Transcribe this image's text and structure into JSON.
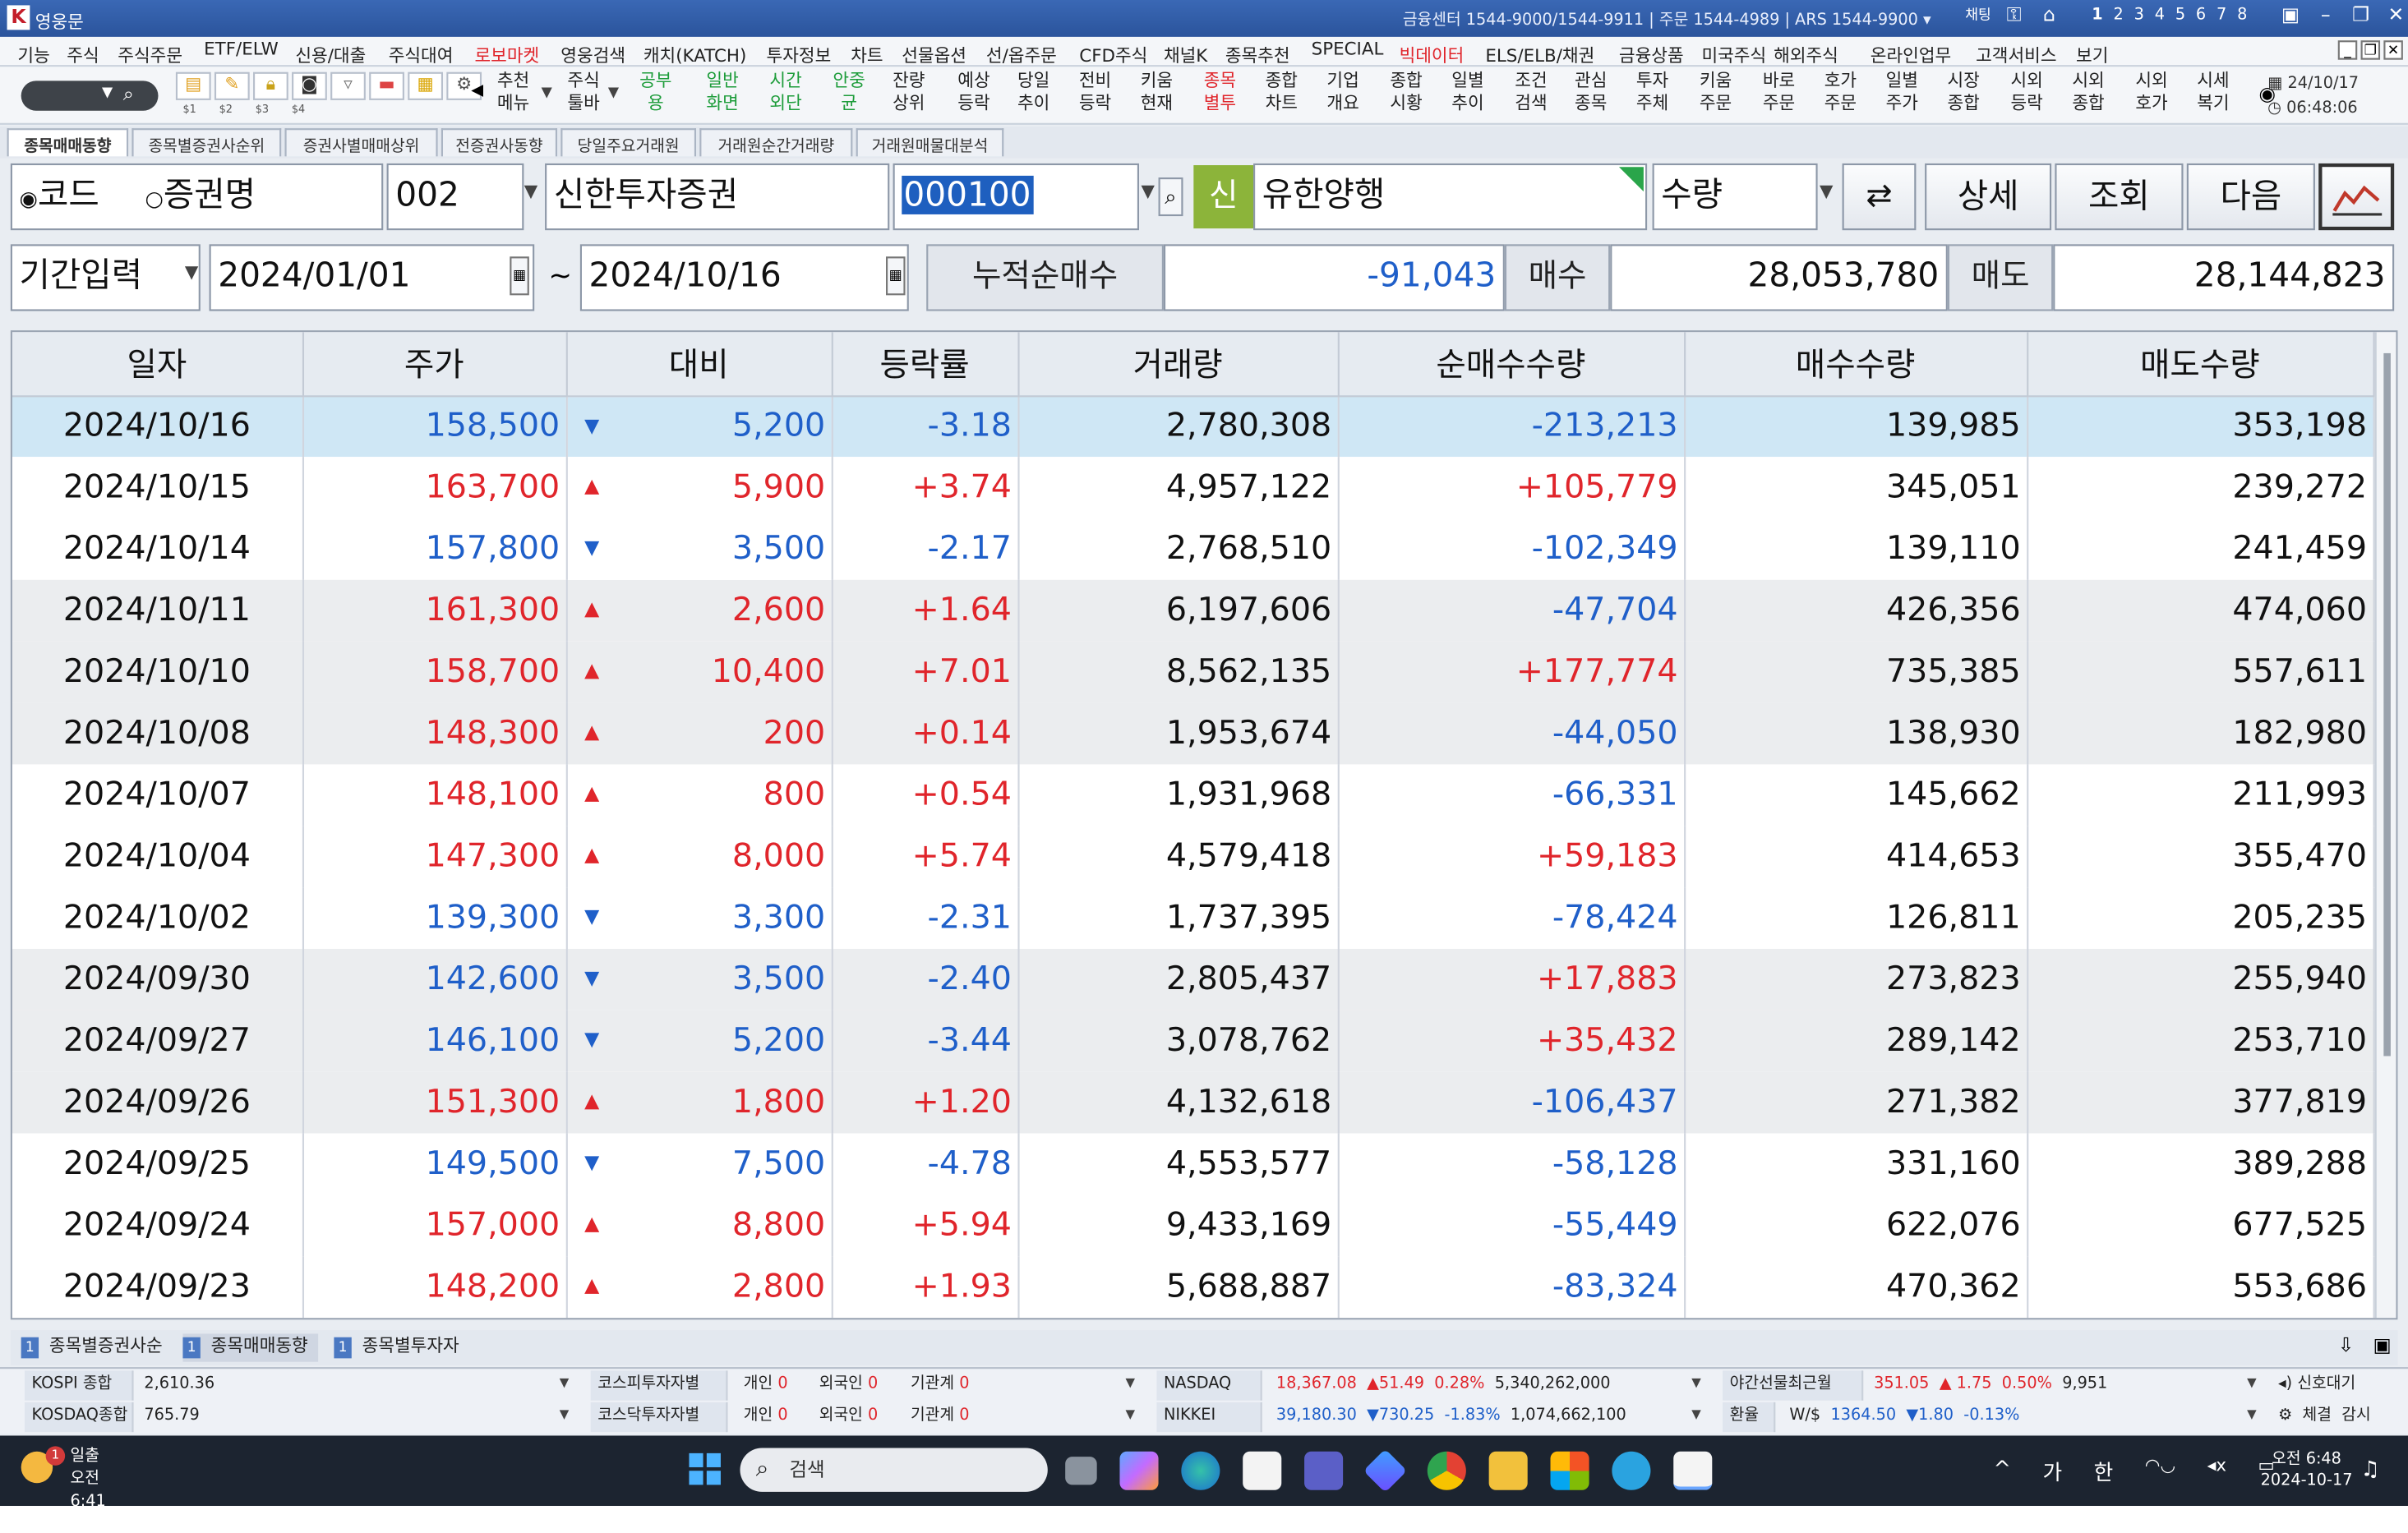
{
  "window": {
    "app_title": "영웅문",
    "contact": "금융센터 1544-9000/1544-9911 | 주문 1544-4989 | ARS 1544-9900 ▾",
    "screen_nums": [
      "1",
      "2",
      "3",
      "4",
      "5",
      "6",
      "7",
      "8"
    ],
    "chat": "채팅"
  },
  "menu": [
    "기능",
    "주식",
    "주식주문",
    "ETF/ELW",
    "신용/대출",
    "주식대여",
    "로보마켓",
    "영웅검색",
    "캐치(KATCH)",
    "투자정보",
    "차트",
    "선물옵션",
    "선/옵주문",
    "CFD주식",
    "채널K",
    "종목추천",
    "SPECIAL",
    "빅데이터",
    "ELS/ELB/채권",
    "금융상품",
    "미국주식",
    "해외주식",
    "온라인업무",
    "고객서비스",
    "보기"
  ],
  "toolbar": {
    "slots": [
      "$1",
      "$2",
      "$3",
      "$4"
    ],
    "tools": [
      {
        "l1": "추천",
        "l2": "메뉴",
        "c": ""
      },
      {
        "l1": "주식",
        "l2": "툴바",
        "c": ""
      },
      {
        "l1": "공부",
        "l2": "용",
        "c": "green"
      },
      {
        "l1": "일반",
        "l2": "화면",
        "c": "green"
      },
      {
        "l1": "시간",
        "l2": "외단",
        "c": "green"
      },
      {
        "l1": "안중",
        "l2": "균",
        "c": "green"
      },
      {
        "l1": "잔량",
        "l2": "상위",
        "c": ""
      },
      {
        "l1": "예상",
        "l2": "등락",
        "c": ""
      },
      {
        "l1": "당일",
        "l2": "추이",
        "c": ""
      },
      {
        "l1": "전비",
        "l2": "등락",
        "c": ""
      },
      {
        "l1": "키움",
        "l2": "현재",
        "c": ""
      },
      {
        "l1": "종목",
        "l2": "별투",
        "c": "red"
      },
      {
        "l1": "종합",
        "l2": "차트",
        "c": ""
      },
      {
        "l1": "기업",
        "l2": "개요",
        "c": ""
      },
      {
        "l1": "종합",
        "l2": "시황",
        "c": ""
      },
      {
        "l1": "일별",
        "l2": "추이",
        "c": ""
      },
      {
        "l1": "조건",
        "l2": "검색",
        "c": ""
      },
      {
        "l1": "관심",
        "l2": "종목",
        "c": ""
      },
      {
        "l1": "투자",
        "l2": "주체",
        "c": ""
      },
      {
        "l1": "키움",
        "l2": "주문",
        "c": ""
      },
      {
        "l1": "바로",
        "l2": "주문",
        "c": ""
      },
      {
        "l1": "호가",
        "l2": "주문",
        "c": ""
      },
      {
        "l1": "일별",
        "l2": "주가",
        "c": ""
      },
      {
        "l1": "시장",
        "l2": "종합",
        "c": ""
      },
      {
        "l1": "시외",
        "l2": "등락",
        "c": ""
      },
      {
        "l1": "시외",
        "l2": "종합",
        "c": ""
      },
      {
        "l1": "시외",
        "l2": "호가",
        "c": ""
      },
      {
        "l1": "시세",
        "l2": "복기",
        "c": ""
      }
    ],
    "date": "24/10/17",
    "time": "06:48:06"
  },
  "tabs": [
    "종목매매동향",
    "종목별증권사순위",
    "증권사별매매상위",
    "전증권사동향",
    "당일주요거래원",
    "거래원순간거래량",
    "거래원매물대분석"
  ],
  "form": {
    "radio_code": "코드",
    "radio_name": "증권명",
    "broker_code": "002",
    "broker_name": "신한투자증권",
    "stock_code": "000100",
    "stock_badge": "신",
    "stock_name": "유한양행",
    "unit": "수량",
    "btn_detail": "상세",
    "btn_query": "조회",
    "btn_next": "다음",
    "period_label": "기간입력",
    "date_from": "2024/01/01",
    "tilde": "~",
    "date_to": "2024/10/16",
    "cum_net_label": "누적순매수",
    "cum_net_value": "-91,043",
    "buy_label": "매수",
    "buy_value": "28,053,780",
    "sell_label": "매도",
    "sell_value": "28,144,823"
  },
  "columns": [
    "일자",
    "주가",
    "대비",
    "등락률",
    "거래량",
    "순매수수량",
    "매수수량",
    "매도수량"
  ],
  "rows": [
    {
      "date": "2024/10/16",
      "price": "158,500",
      "dir": "down",
      "diff": "5,200",
      "rate": "-3.18",
      "vol": "2,780,308",
      "net": "-213,213",
      "buy": "139,985",
      "sell": "353,198"
    },
    {
      "date": "2024/10/15",
      "price": "163,700",
      "dir": "up",
      "diff": "5,900",
      "rate": "+3.74",
      "vol": "4,957,122",
      "net": "+105,779",
      "buy": "345,051",
      "sell": "239,272"
    },
    {
      "date": "2024/10/14",
      "price": "157,800",
      "dir": "down",
      "diff": "3,500",
      "rate": "-2.17",
      "vol": "2,768,510",
      "net": "-102,349",
      "buy": "139,110",
      "sell": "241,459"
    },
    {
      "date": "2024/10/11",
      "price": "161,300",
      "dir": "up",
      "diff": "2,600",
      "rate": "+1.64",
      "vol": "6,197,606",
      "net": "-47,704",
      "buy": "426,356",
      "sell": "474,060"
    },
    {
      "date": "2024/10/10",
      "price": "158,700",
      "dir": "up",
      "diff": "10,400",
      "rate": "+7.01",
      "vol": "8,562,135",
      "net": "+177,774",
      "buy": "735,385",
      "sell": "557,611"
    },
    {
      "date": "2024/10/08",
      "price": "148,300",
      "dir": "up",
      "diff": "200",
      "rate": "+0.14",
      "vol": "1,953,674",
      "net": "-44,050",
      "buy": "138,930",
      "sell": "182,980"
    },
    {
      "date": "2024/10/07",
      "price": "148,100",
      "dir": "up",
      "diff": "800",
      "rate": "+0.54",
      "vol": "1,931,968",
      "net": "-66,331",
      "buy": "145,662",
      "sell": "211,993"
    },
    {
      "date": "2024/10/04",
      "price": "147,300",
      "dir": "up",
      "diff": "8,000",
      "rate": "+5.74",
      "vol": "4,579,418",
      "net": "+59,183",
      "buy": "414,653",
      "sell": "355,470"
    },
    {
      "date": "2024/10/02",
      "price": "139,300",
      "dir": "down",
      "diff": "3,300",
      "rate": "-2.31",
      "vol": "1,737,395",
      "net": "-78,424",
      "buy": "126,811",
      "sell": "205,235"
    },
    {
      "date": "2024/09/30",
      "price": "142,600",
      "dir": "down",
      "diff": "3,500",
      "rate": "-2.40",
      "vol": "2,805,437",
      "net": "+17,883",
      "buy": "273,823",
      "sell": "255,940"
    },
    {
      "date": "2024/09/27",
      "price": "146,100",
      "dir": "down",
      "diff": "5,200",
      "rate": "-3.44",
      "vol": "3,078,762",
      "net": "+35,432",
      "buy": "289,142",
      "sell": "253,710"
    },
    {
      "date": "2024/09/26",
      "price": "151,300",
      "dir": "up",
      "diff": "1,800",
      "rate": "+1.20",
      "vol": "4,132,618",
      "net": "-106,437",
      "buy": "271,382",
      "sell": "377,819"
    },
    {
      "date": "2024/09/25",
      "price": "149,500",
      "dir": "down",
      "diff": "7,500",
      "rate": "-4.78",
      "vol": "4,553,577",
      "net": "-58,128",
      "buy": "331,160",
      "sell": "389,288"
    },
    {
      "date": "2024/09/24",
      "price": "157,000",
      "dir": "up",
      "diff": "8,800",
      "rate": "+5.94",
      "vol": "9,433,169",
      "net": "-55,449",
      "buy": "622,076",
      "sell": "677,525"
    },
    {
      "date": "2024/09/23",
      "price": "148,200",
      "dir": "up",
      "diff": "2,800",
      "rate": "+1.93",
      "vol": "5,688,887",
      "net": "-83,324",
      "buy": "470,362",
      "sell": "553,686"
    }
  ],
  "bottom_tabs": [
    {
      "num": "1",
      "label": "종목별증권사순"
    },
    {
      "num": "1",
      "label": "종목매매동향"
    },
    {
      "num": "1",
      "label": "종목별투자자"
    }
  ],
  "status": {
    "kospi_label": "KOSPI 종합",
    "kospi_value": "2,610.36",
    "kosdaq_label": "KOSDAQ종합",
    "kosdaq_value": "765.79",
    "kospi_inv_label": "코스피투자자별",
    "kosdaq_inv_label": "코스닥투자자별",
    "inv_individual": "개인",
    "inv_foreign": "외국인",
    "inv_inst": "기관계",
    "inv_zero": "0",
    "nasdaq_label": "NASDAQ",
    "nasdaq_value": "18,367.08",
    "nasdaq_chg": "▲51.49",
    "nasdaq_pct": "0.28%",
    "nasdaq_vol": "5,340,262,000",
    "nikkei_label": "NIKKEI",
    "nikkei_value": "39,180.30",
    "nikkei_chg": "▼730.25",
    "nikkei_pct": "-1.83%",
    "nikkei_vol": "1,074,662,100",
    "night_label": "야간선물최근월",
    "night_value": "351.05",
    "night_chg": "▲ 1.75",
    "night_pct": "0.50%",
    "night_vol": "9,951",
    "fx_label": "환율",
    "fx_pair": "W/$",
    "fx_value": "1364.50",
    "fx_chg": "▼1.80",
    "fx_pct": "-0.13%",
    "signal": "신호대기",
    "fill": "체결",
    "watch": "감시"
  },
  "taskbar": {
    "weather_title": "일출",
    "weather_time": "오전 6:41",
    "weather_badge": "1",
    "search": "검색",
    "ime1": "가",
    "ime2": "한",
    "time": "오전 6:48",
    "date": "2024-10-17"
  }
}
